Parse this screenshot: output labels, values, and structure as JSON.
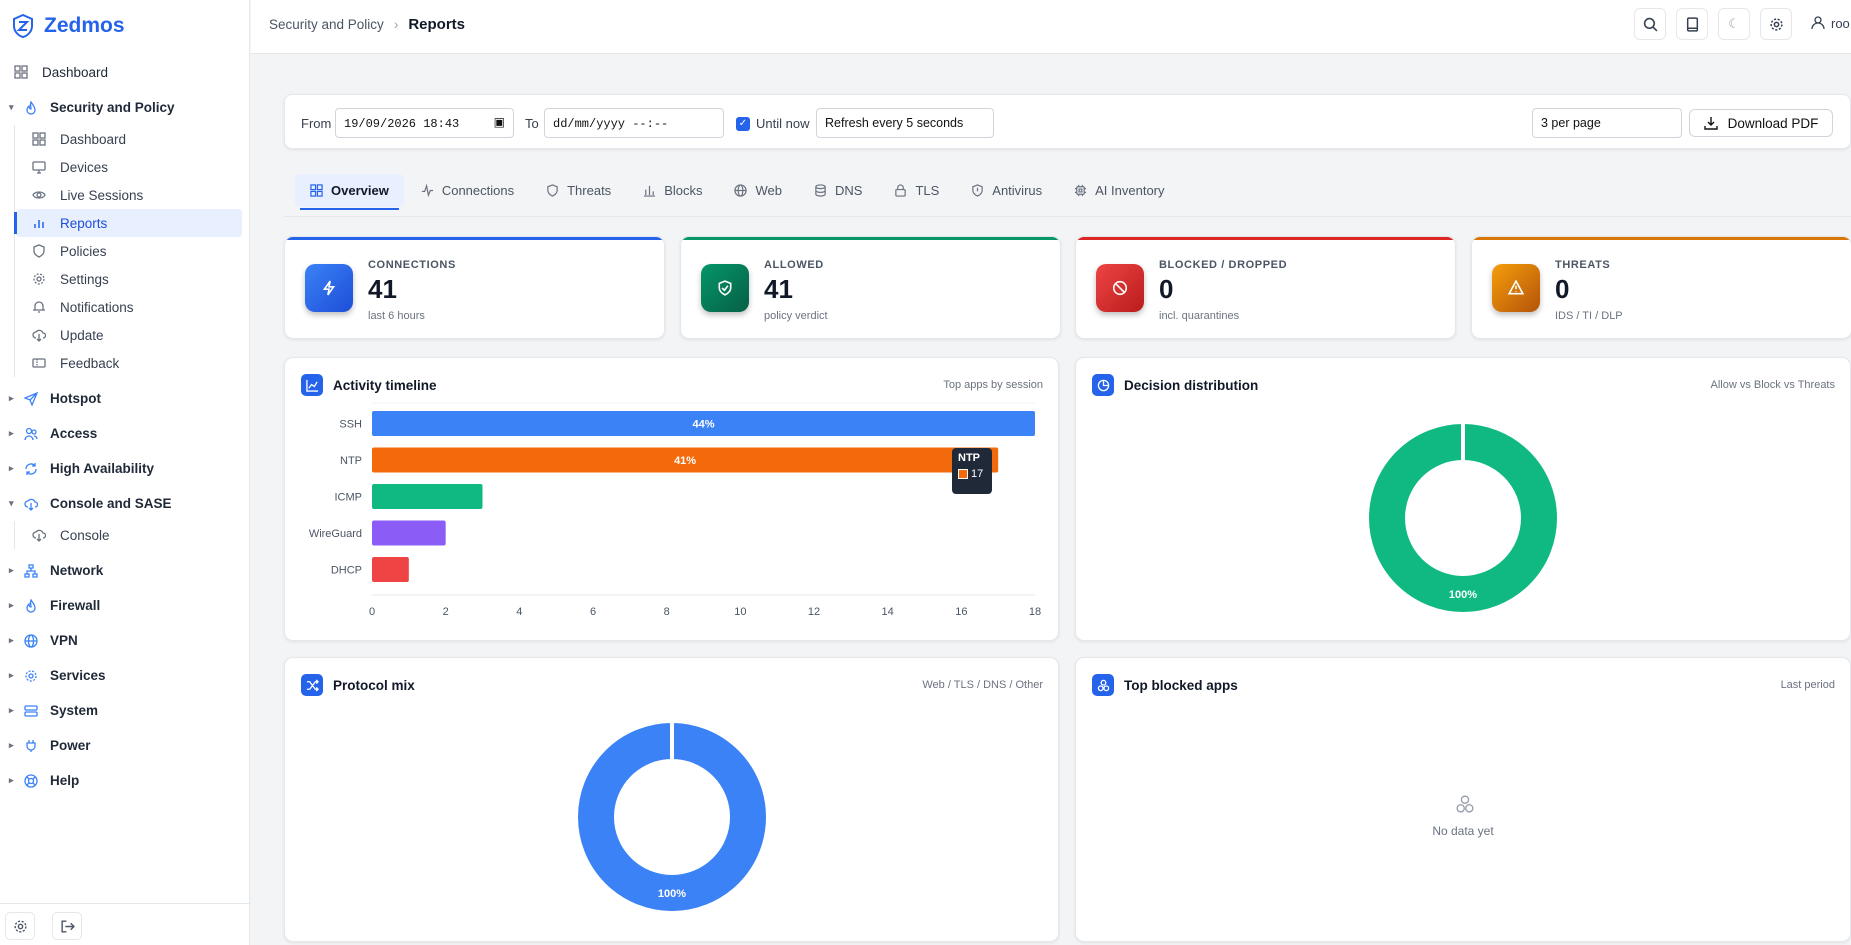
{
  "app": {
    "name": "Zedmos"
  },
  "sidebar": {
    "dashboard": "Dashboard",
    "security_group": "Security and Policy",
    "security_items": [
      "Dashboard",
      "Devices",
      "Live Sessions",
      "Reports",
      "Policies",
      "Settings",
      "Notifications",
      "Update",
      "Feedback"
    ],
    "hotspot": "Hotspot",
    "access": "Access",
    "ha": "High Availability",
    "console_group": "Console and SASE",
    "console_item": "Console",
    "network": "Network",
    "firewall": "Firewall",
    "vpn": "VPN",
    "services": "Services",
    "system": "System",
    "power": "Power",
    "help": "Help"
  },
  "header": {
    "crumb_parent": "Security and Policy",
    "crumb_current": "Reports",
    "user": "roo"
  },
  "filters": {
    "from_label": "From",
    "from_value": "19/09/2026 18:43",
    "to_label": "To",
    "to_placeholder": "dd/mm/yyyy --:--",
    "until_now": "Until now",
    "refresh": "Refresh every 5 seconds",
    "per_page": "3 per page",
    "download": "Download PDF"
  },
  "tabs": [
    "Overview",
    "Connections",
    "Threats",
    "Blocks",
    "Web",
    "DNS",
    "TLS",
    "Antivirus",
    "AI Inventory"
  ],
  "stats": [
    {
      "title": "CONNECTIONS",
      "value": "41",
      "sub": "last 6 hours",
      "color": "#2563eb"
    },
    {
      "title": "ALLOWED",
      "value": "41",
      "sub": "policy verdict",
      "color": "#047857"
    },
    {
      "title": "BLOCKED / DROPPED",
      "value": "0",
      "sub": "incl. quarantines",
      "color": "#dc2626"
    },
    {
      "title": "THREATS",
      "value": "0",
      "sub": "IDS / TI / DLP",
      "color": "#d97706"
    }
  ],
  "cards": {
    "timeline": {
      "title": "Activity timeline",
      "sub": "Top apps by session"
    },
    "decision": {
      "title": "Decision distribution",
      "sub": "Allow vs Block vs Threats"
    },
    "protocol": {
      "title": "Protocol mix",
      "sub": "Web / TLS / DNS / Other"
    },
    "blocked": {
      "title": "Top blocked apps",
      "sub": "Last period",
      "empty": "No data yet"
    }
  },
  "tooltip": {
    "label": "NTP",
    "value": "17"
  },
  "chart_data": [
    {
      "type": "bar",
      "orientation": "horizontal",
      "categories": [
        "SSH",
        "NTP",
        "ICMP",
        "WireGuard",
        "DHCP"
      ],
      "values": [
        18,
        17,
        3,
        2,
        1
      ],
      "colors": [
        "#3b82f6",
        "#f26a0b",
        "#10b981",
        "#8b5cf6",
        "#ef4444"
      ],
      "data_labels": [
        "44%",
        "41%",
        "",
        "",
        ""
      ],
      "xlim": [
        0,
        18
      ],
      "xticks": [
        "0",
        "2",
        "4",
        "6",
        "8",
        "10",
        "12",
        "14",
        "16",
        "18"
      ]
    },
    {
      "type": "pie",
      "donut": true,
      "values": [
        100
      ],
      "labels": [
        "100%"
      ],
      "colors": [
        "#10b981"
      ]
    },
    {
      "type": "pie",
      "donut": true,
      "values": [
        100
      ],
      "labels": [
        "100%"
      ],
      "colors": [
        "#3b82f6"
      ]
    }
  ]
}
